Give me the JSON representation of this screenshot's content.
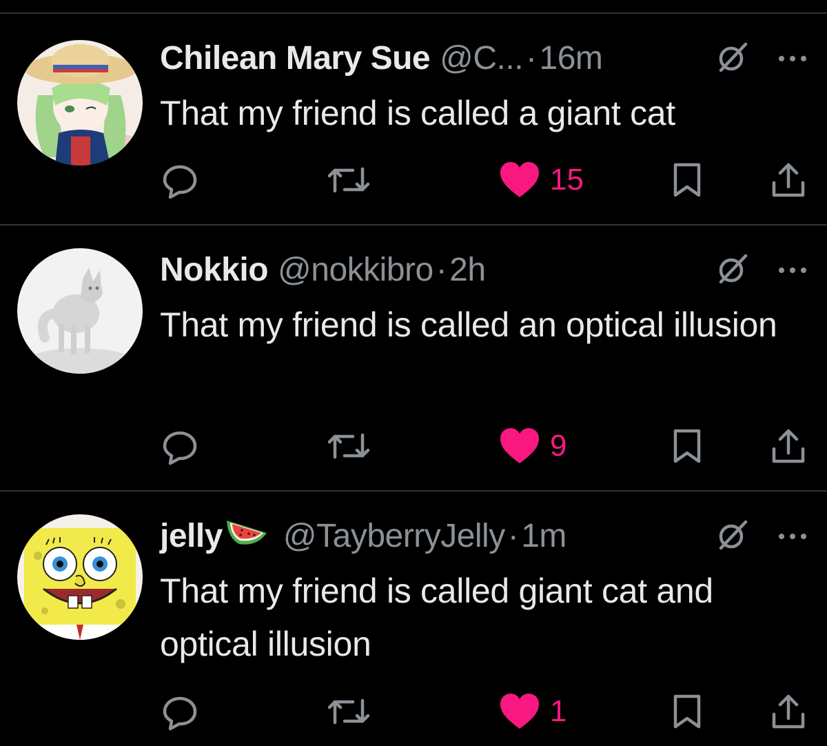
{
  "colors": {
    "background": "#000000",
    "text": "#e7e9ea",
    "muted": "#8b9196",
    "like": "#f91880",
    "divider": "#2f3336"
  },
  "posts": [
    {
      "display_name": "Chilean Mary Sue",
      "display_name_emoji": "",
      "handle": "@C...",
      "separator": "·",
      "time": "16m",
      "text": "That my friend is called a giant cat",
      "likes": "15",
      "liked": true,
      "avatar": "anime-girl-straw-hat-avatar"
    },
    {
      "display_name": "Nokkio",
      "display_name_emoji": "",
      "handle": "@nokkibro",
      "separator": "·",
      "time": "2h",
      "text": "That my friend is called an optical illusion",
      "likes": "9",
      "liked": true,
      "avatar": "white-fox-avatar"
    },
    {
      "display_name": "jelly",
      "display_name_emoji": "watermelon",
      "handle": "@TayberryJelly",
      "separator": "·",
      "time": "1m",
      "text": "That my friend is called giant cat and optical illusion",
      "likes": "1",
      "liked": true,
      "avatar": "spongebob-avatar"
    }
  ],
  "icons": {
    "reply": "reply-icon",
    "repost": "repost-icon",
    "like": "heart-icon",
    "bookmark": "bookmark-icon",
    "share": "share-icon",
    "grok": "grok-icon",
    "more": "more-icon"
  }
}
